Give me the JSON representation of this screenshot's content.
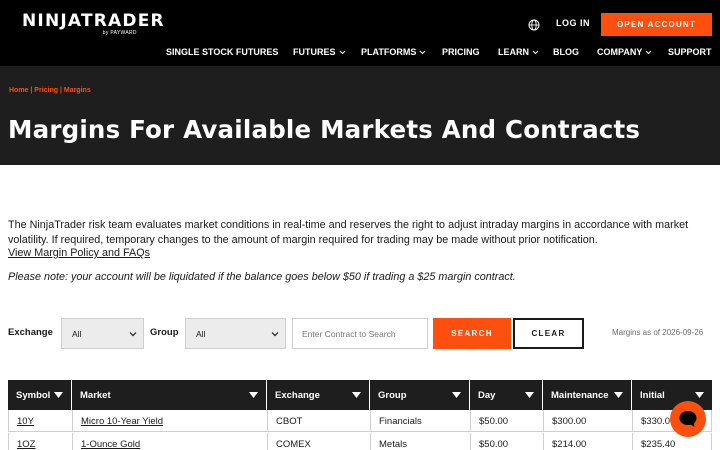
{
  "header": {
    "logo": "NINJATRADER",
    "logo_sub": "by PAYWARD",
    "login": "LOG IN",
    "open_account": "OPEN ACCOUNT"
  },
  "nav": {
    "items": [
      {
        "label": "SINGLE STOCK FUTURES",
        "has_dropdown": false
      },
      {
        "label": "FUTURES",
        "has_dropdown": true
      },
      {
        "label": "PLATFORMS",
        "has_dropdown": true
      },
      {
        "label": "PRICING",
        "has_dropdown": false
      },
      {
        "label": "LEARN",
        "has_dropdown": true
      },
      {
        "label": "BLOG",
        "has_dropdown": false
      },
      {
        "label": "COMPANY",
        "has_dropdown": true
      },
      {
        "label": "SUPPORT",
        "has_dropdown": false
      }
    ]
  },
  "hero": {
    "breadcrumb": "Home | Pricing | Margins",
    "title": "Margins For Available Markets And Contracts"
  },
  "content": {
    "intro": "The NinjaTrader risk team evaluates market conditions in real-time and reserves the right to adjust intraday margins in accordance with market volatility. If required, temporary changes to the amount of margin required for trading may be made without prior notification.",
    "policy_link": "View Margin Policy and FAQs",
    "note": "Please note: your account will be liquidated if the balance goes below $50 if trading a $25 margin contract."
  },
  "filters": {
    "exchange_label": "Exchange",
    "exchange_value": "All",
    "group_label": "Group",
    "group_value": "All",
    "search_placeholder": "Enter Contract to Search",
    "search_button": "SEARCH",
    "clear_button": "CLEAR",
    "as_of": "Margins as of 2026-09-26"
  },
  "table": {
    "headers": [
      "Symbol",
      "Market",
      "Exchange",
      "Group",
      "Day",
      "Maintenance",
      "Initial"
    ],
    "rows": [
      [
        "10Y",
        "Micro 10-Year Yield",
        "CBOT",
        "Financials",
        "$50.00",
        "$300.00",
        "$330.00"
      ],
      [
        "1OZ",
        "1-Ounce Gold",
        "COMEX",
        "Metals",
        "$50.00",
        "$214.00",
        "$235.40"
      ]
    ]
  },
  "colors": {
    "accent": "#ff4f0e",
    "header_bg": "#000000",
    "hero_bg": "#1e1e1e"
  },
  "icons": {
    "language": "globe-icon",
    "chat": "chat-bubble-icon",
    "dropdown": "chevron-down-icon",
    "sort": "sort-down-icon"
  }
}
